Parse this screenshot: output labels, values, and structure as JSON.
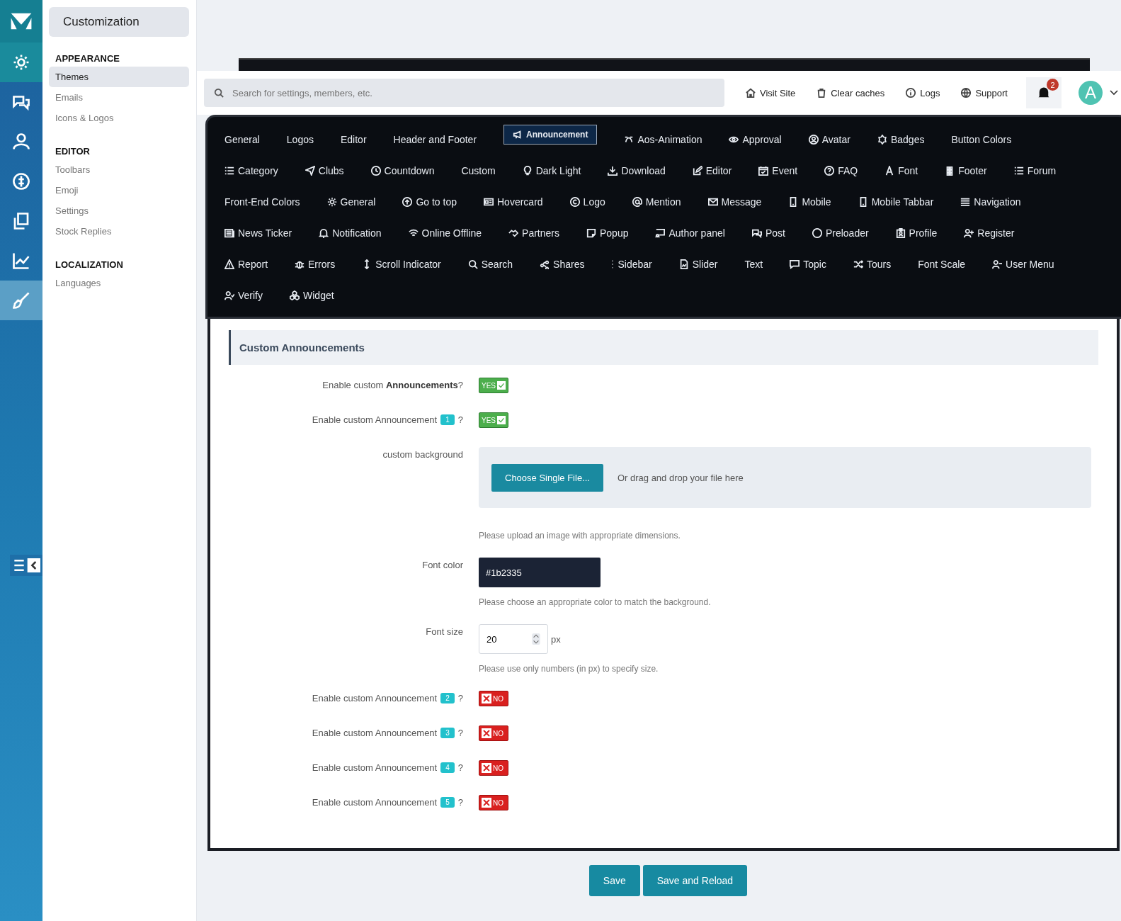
{
  "rail": {
    "items": [
      {
        "selected": false,
        "highlighted": true
      },
      {
        "selected": false,
        "highlighted": false
      },
      {
        "selected": false,
        "highlighted": false
      },
      {
        "selected": false,
        "highlighted": false
      },
      {
        "selected": false,
        "highlighted": false
      },
      {
        "selected": false,
        "highlighted": false
      },
      {
        "selected": true,
        "highlighted": false
      }
    ]
  },
  "sidebar": {
    "title": "Customization",
    "sections": [
      {
        "heading": "APPEARANCE",
        "items": [
          {
            "label": "Themes",
            "selected": true
          },
          {
            "label": "Emails",
            "selected": false
          },
          {
            "label": "Icons & Logos",
            "selected": false
          }
        ]
      },
      {
        "heading": "EDITOR",
        "items": [
          {
            "label": "Toolbars",
            "selected": false
          },
          {
            "label": "Emoji",
            "selected": false
          },
          {
            "label": "Settings",
            "selected": false
          },
          {
            "label": "Stock Replies",
            "selected": false
          }
        ]
      },
      {
        "heading": "LOCALIZATION",
        "items": [
          {
            "label": "Languages",
            "selected": false
          }
        ]
      }
    ]
  },
  "topbar": {
    "search": {
      "placeholder": "Search for settings, members, etc."
    },
    "links": [
      "Visit Site",
      "Clear caches",
      "Logs",
      "Support"
    ],
    "notifications": "2",
    "avatar": "A"
  },
  "tab_rows": [
    [
      {
        "label": "General",
        "selected": false
      },
      {
        "label": "Logos",
        "selected": false
      },
      {
        "label": "Editor",
        "selected": false
      },
      {
        "label": "Header and Footer",
        "selected": false
      },
      {
        "label": "Announcement",
        "selected": true
      },
      {
        "label": "Aos-Animation",
        "selected": false
      },
      {
        "label": "Approval",
        "selected": false
      },
      {
        "label": "Avatar",
        "selected": false
      },
      {
        "label": "Badges",
        "selected": false
      },
      {
        "label": "Button Colors",
        "selected": false
      }
    ],
    [
      {
        "label": "Category",
        "selected": false
      },
      {
        "label": "Clubs",
        "selected": false
      },
      {
        "label": "Countdown",
        "selected": false
      },
      {
        "label": "Custom",
        "selected": false
      },
      {
        "label": "Dark Light",
        "selected": false
      },
      {
        "label": "Download",
        "selected": false
      },
      {
        "label": "Editor",
        "selected": false
      },
      {
        "label": "Event",
        "selected": false
      },
      {
        "label": "FAQ",
        "selected": false
      },
      {
        "label": "Font",
        "selected": false
      },
      {
        "label": "Footer",
        "selected": false
      },
      {
        "label": "Forum",
        "selected": false
      }
    ],
    [
      {
        "label": "Front-End Colors",
        "selected": false
      },
      {
        "label": "General",
        "selected": false
      },
      {
        "label": "Go to top",
        "selected": false
      },
      {
        "label": "Hovercard",
        "selected": false
      },
      {
        "label": "Logo",
        "selected": false
      },
      {
        "label": "Mention",
        "selected": false
      },
      {
        "label": "Message",
        "selected": false
      },
      {
        "label": "Mobile",
        "selected": false
      },
      {
        "label": "Mobile Tabbar",
        "selected": false
      },
      {
        "label": "Navigation",
        "selected": false
      }
    ],
    [
      {
        "label": "News Ticker",
        "selected": false
      },
      {
        "label": "Notification",
        "selected": false
      },
      {
        "label": "Online Offline",
        "selected": false
      },
      {
        "label": "Partners",
        "selected": false
      },
      {
        "label": "Popup",
        "selected": false
      },
      {
        "label": "Author panel",
        "selected": false
      },
      {
        "label": "Post",
        "selected": false
      },
      {
        "label": "Preloader",
        "selected": false
      },
      {
        "label": "Profile",
        "selected": false
      },
      {
        "label": "Register",
        "selected": false
      }
    ],
    [
      {
        "label": "Report",
        "selected": false
      },
      {
        "label": "Errors",
        "selected": false
      },
      {
        "label": "Scroll Indicator",
        "selected": false
      },
      {
        "label": "Search",
        "selected": false
      },
      {
        "label": "Shares",
        "selected": false
      },
      {
        "label": "Sidebar",
        "selected": false
      },
      {
        "label": "Slider",
        "selected": false
      },
      {
        "label": "Text",
        "selected": false
      },
      {
        "label": "Topic",
        "selected": false
      },
      {
        "label": "Tours",
        "selected": false
      },
      {
        "label": "Font Scale",
        "selected": false
      },
      {
        "label": "User Menu",
        "selected": false
      }
    ],
    [
      {
        "label": "Verify",
        "selected": false
      },
      {
        "label": "Widget",
        "selected": false
      }
    ]
  ],
  "form": {
    "title": "Custom Announcements",
    "rows": [
      {
        "kind": "toggle",
        "label": "Enable custom **Announcements**?",
        "on": true,
        "toggle_text": "YES"
      },
      {
        "kind": "toggle",
        "label": "Enable custom Announcement",
        "badge": "1",
        "suffix": "?",
        "on": true,
        "toggle_text": "YES"
      },
      {
        "kind": "file",
        "label": "custom background",
        "button": "Choose Single File...",
        "drop_hint": "Or drag and drop your file here",
        "help": "Please upload an image with appropriate dimensions."
      },
      {
        "kind": "color",
        "label": "Font color",
        "value": "#1b2335",
        "help": "Please choose an appropriate color to match the background."
      },
      {
        "kind": "number",
        "label": "Font size",
        "value": "20",
        "unit": "px",
        "help": "Please use only numbers (in px) to specify size."
      },
      {
        "kind": "toggle",
        "label": "Enable custom Announcement",
        "badge": "2",
        "suffix": "?",
        "on": false,
        "toggle_text": "NO"
      },
      {
        "kind": "toggle",
        "label": "Enable custom Announcement",
        "badge": "3",
        "suffix": "?",
        "on": false,
        "toggle_text": "NO"
      },
      {
        "kind": "toggle",
        "label": "Enable custom Announcement",
        "badge": "4",
        "suffix": "?",
        "on": false,
        "toggle_text": "NO"
      },
      {
        "kind": "toggle",
        "label": "Enable custom Announcement",
        "badge": "5",
        "suffix": "?",
        "on": false,
        "toggle_text": "NO"
      }
    ]
  },
  "buttons": [
    "Save",
    "Save and Reload"
  ]
}
